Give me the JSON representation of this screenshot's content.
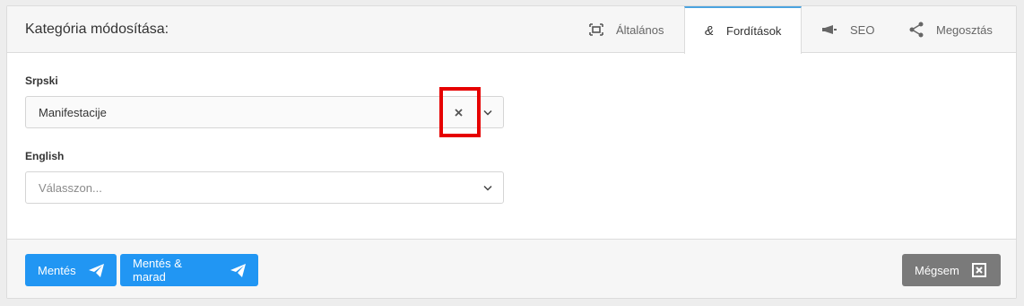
{
  "header": {
    "title": "Kategória módosítása:",
    "tabs": [
      {
        "label": "Általános",
        "icon": "frame-icon"
      },
      {
        "label": "Fordítások",
        "icon": "ampersand-icon"
      },
      {
        "label": "SEO",
        "icon": "megaphone-icon"
      },
      {
        "label": "Megosztás",
        "icon": "share-icon"
      }
    ],
    "active_tab": "Fordítások"
  },
  "form": {
    "fields": [
      {
        "label": "Srpski",
        "value": "Manifestacije",
        "placeholder": ""
      },
      {
        "label": "English",
        "value": "",
        "placeholder": "Válasszon..."
      }
    ]
  },
  "footer": {
    "save_label": "Mentés",
    "save_stay_label": "Mentés & marad",
    "cancel_label": "Mégsem"
  },
  "colors": {
    "primary": "#2196f3",
    "cancel": "#7a7a7a",
    "tab_active_border": "#4aa3df",
    "highlight": "#e60000"
  }
}
